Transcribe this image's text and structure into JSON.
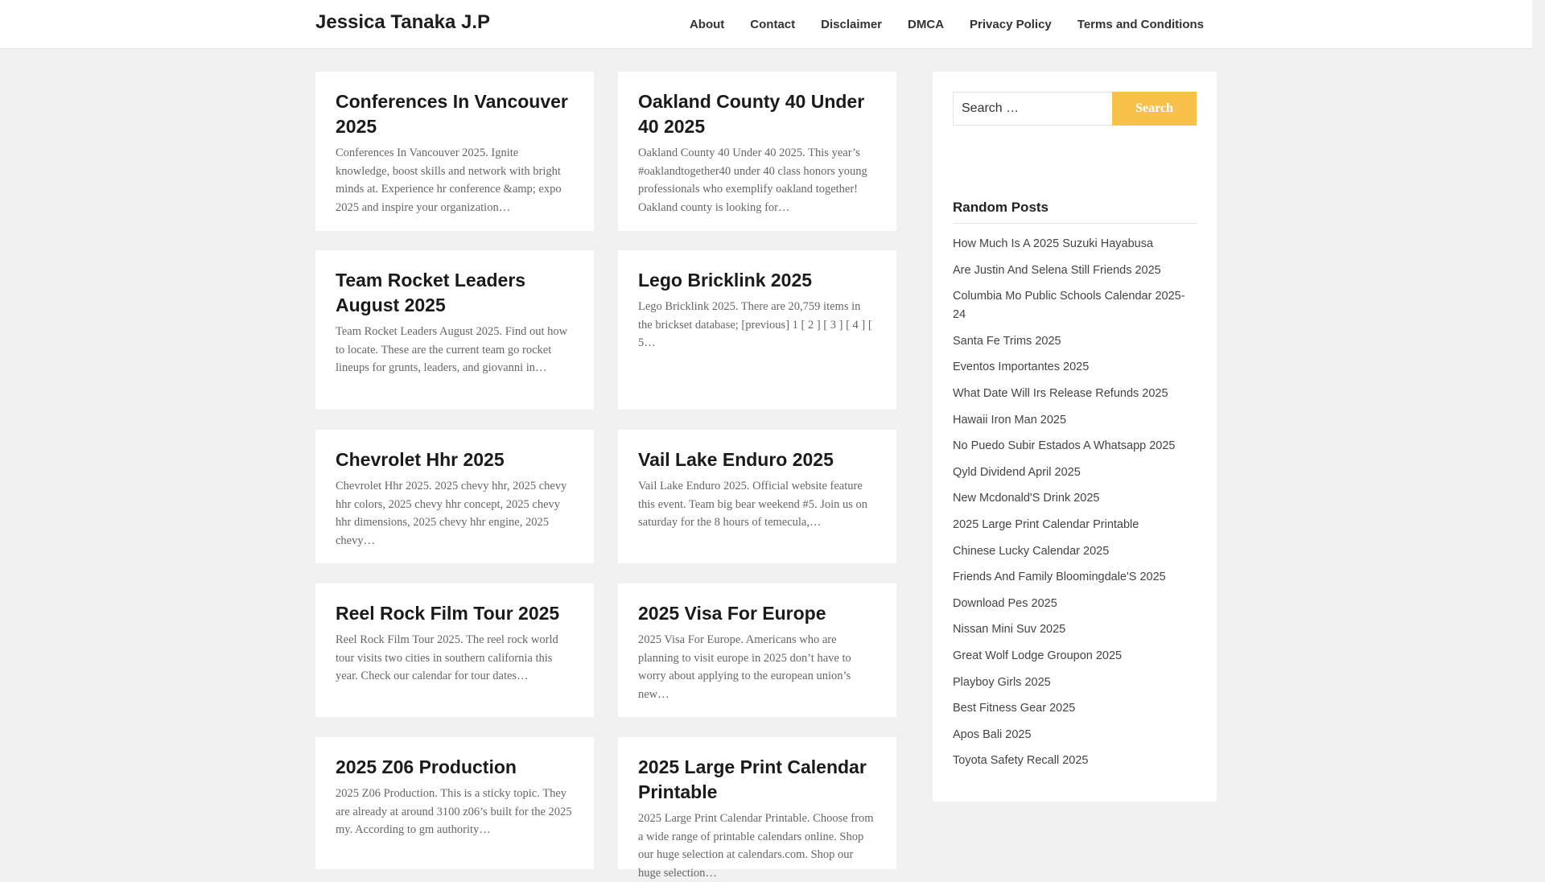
{
  "site": {
    "title": "Jessica Tanaka J.P"
  },
  "nav": [
    {
      "label": "About"
    },
    {
      "label": "Contact"
    },
    {
      "label": "Disclaimer"
    },
    {
      "label": "DMCA"
    },
    {
      "label": "Privacy Policy"
    },
    {
      "label": "Terms and Conditions"
    }
  ],
  "posts": [
    {
      "title": "Conferences In Vancouver 2025",
      "excerpt": "Conferences In Vancouver 2025. Ignite knowledge, boost skills and network with bright minds at. Experience hr conference &amp; expo 2025 and inspire your organization…"
    },
    {
      "title": "Oakland County 40 Under 40 2025",
      "excerpt": "Oakland County 40 Under 40 2025. This year’s #oaklandtogether40 under 40 class honors young professionals who exemplify oakland together! Oakland county is looking for…"
    },
    {
      "title": "Team Rocket Leaders August 2025",
      "excerpt": "Team Rocket Leaders August 2025. Find out how to locate. These are the current team go rocket lineups for grunts, leaders, and giovanni in…"
    },
    {
      "title": "Lego Bricklink 2025",
      "excerpt": "Lego Bricklink 2025. There are 20,759 items in the brickset database; [previous] 1 [ 2 ] [ 3 ] [ 4 ] [ 5…"
    },
    {
      "title": "Chevrolet Hhr 2025",
      "excerpt": "Chevrolet Hhr 2025. 2025 chevy hhr, 2025 chevy hhr colors, 2025 chevy hhr concept, 2025 chevy hhr dimensions, 2025 chevy hhr engine, 2025 chevy…"
    },
    {
      "title": "Vail Lake Enduro 2025",
      "excerpt": "Vail Lake Enduro 2025. Official website feature this event. Team big bear weekend #5. Join us on saturday for the 8 hours of temecula,…"
    },
    {
      "title": "Reel Rock Film Tour 2025",
      "excerpt": "Reel Rock Film Tour 2025. The reel rock world tour visits two cities in southern california this year. Check our calendar for tour dates…"
    },
    {
      "title": "2025 Visa For Europe",
      "excerpt": "2025 Visa For Europe. Americans who are planning to visit europe in 2025 don’t have to worry about applying to the european union’s new…"
    },
    {
      "title": "2025 Z06 Production",
      "excerpt": "2025 Z06 Production. This is a sticky topic. They are already at around 3100 z06’s built for the 2025 my. According to gm authority…"
    },
    {
      "title": "2025 Large Print Calendar Printable",
      "excerpt": "2025 Large Print Calendar Printable. Choose from a wide range of printable calendars online. Shop our huge selection at calendars.com. Shop our huge selection…"
    }
  ],
  "sidebar": {
    "search": {
      "placeholder": "Search …",
      "button_label": "Search"
    },
    "random_posts_title": "Random Posts",
    "random_posts": [
      "How Much Is A 2025 Suzuki Hayabusa",
      "Are Justin And Selena Still Friends 2025",
      "Columbia Mo Public Schools Calendar 2025-24",
      "Santa Fe Trims 2025",
      "Eventos Importantes 2025",
      "What Date Will Irs Release Refunds 2025",
      "Hawaii Iron Man 2025",
      "No Puedo Subir Estados A Whatsapp 2025",
      "Qyld Dividend April 2025",
      "New Mcdonald'S Drink 2025",
      "2025 Large Print Calendar Printable",
      "Chinese Lucky Calendar 2025",
      "Friends And Family Bloomingdale'S 2025",
      "Download Pes 2025",
      "Nissan Mini Suv 2025",
      "Great Wolf Lodge Groupon 2025",
      "Playboy Girls 2025",
      "Best Fitness Gear 2025",
      "Apos Bali 2025",
      "Toyota Safety Recall 2025"
    ]
  }
}
